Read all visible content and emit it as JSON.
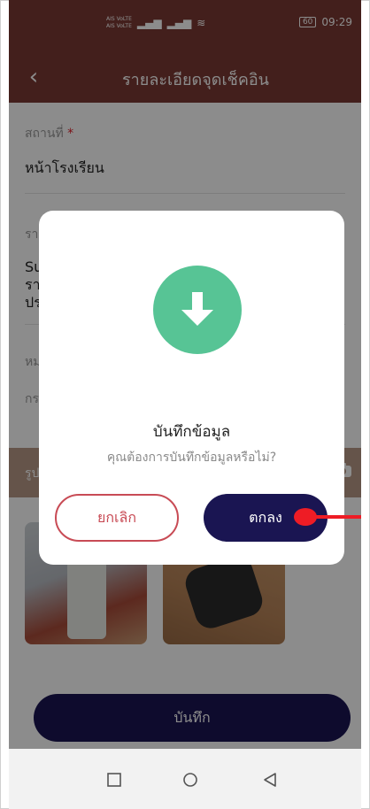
{
  "status": {
    "carrier_top": "AIS VoLTE",
    "carrier_bottom": "AIS VoLTE",
    "battery": "60",
    "time": "09:29"
  },
  "appbar": {
    "title": "รายละเอียดจุดเช็คอิน"
  },
  "form": {
    "location_label": "สถานที่",
    "required_mark": "*",
    "location_value": "หน้าโรงเรียน",
    "detail_label_partial": "รา",
    "detail_value_lines": [
      "Su",
      "รา",
      "ปร"
    ],
    "third_label_partial": "หม",
    "third_value_partial": "กร"
  },
  "photos": {
    "section_label_partial": "รูป"
  },
  "save_button": "บันทึก",
  "dialog": {
    "title": "บันทึกข้อมูล",
    "message": "คุณต้องการบันทึกข้อมูลหรือไม่?",
    "cancel_label": "ยกเลิก",
    "ok_label": "ตกลง"
  },
  "colors": {
    "appbar": "#7a3a33",
    "primary": "#1a1552",
    "success": "#57c495",
    "danger": "#c84b55",
    "annotation": "#ee1c25"
  }
}
